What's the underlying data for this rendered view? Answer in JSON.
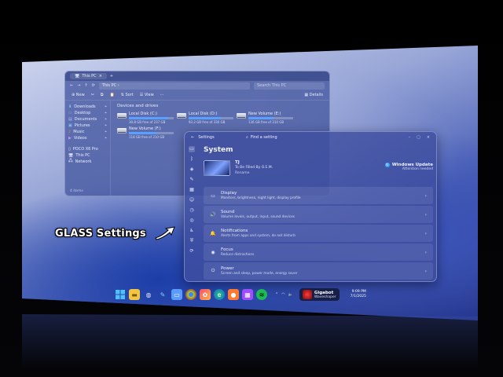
{
  "explorer": {
    "tab_title": "This PC",
    "path": "This PC",
    "search_placeholder": "Search This PC",
    "toolbar": {
      "new_label": "New",
      "sort_label": "Sort",
      "view_label": "View",
      "details_label": "Details"
    },
    "sidebar": [
      {
        "label": "Downloads",
        "icon": "download-icon"
      },
      {
        "label": "Desktop",
        "icon": "desktop-icon"
      },
      {
        "label": "Documents",
        "icon": "document-icon"
      },
      {
        "label": "Pictures",
        "icon": "picture-icon"
      },
      {
        "label": "Music",
        "icon": "music-icon"
      },
      {
        "label": "Videos",
        "icon": "video-icon"
      },
      {
        "label": "POCO X6 Pro",
        "icon": "phone-icon"
      },
      {
        "label": "This PC",
        "icon": "pc-icon"
      },
      {
        "label": "Network",
        "icon": "network-icon"
      }
    ],
    "status": "4 items",
    "section_heading": "Devices and drives",
    "drives": [
      {
        "name": "Local Disk (C:)",
        "free": "30.8 GB free of 237 GB",
        "used_fraction": 0.87
      },
      {
        "name": "Local Disk (D:)",
        "free": "93.2 GB free of 330 GB",
        "used_fraction": 0.72
      },
      {
        "name": "New Volume (E:)",
        "free": "136 GB free of 310 GB",
        "used_fraction": 0.56
      },
      {
        "name": "New Volume (F:)",
        "free": "118 GB free of 310 GB",
        "used_fraction": 0.62
      }
    ]
  },
  "settings": {
    "app_title": "Settings",
    "search_placeholder": "Find a setting",
    "page_title": "System",
    "device": {
      "name": "TJ",
      "model": "To Be Filled By O.E.M.",
      "rename": "Rename"
    },
    "windows_update": {
      "title": "Windows Update",
      "status": "Attention needed"
    },
    "items": [
      {
        "title": "Display",
        "desc": "Monitors, brightness, night light, display profile",
        "icon": "display-icon"
      },
      {
        "title": "Sound",
        "desc": "Volume levels, output, input, sound devices",
        "icon": "sound-icon"
      },
      {
        "title": "Notifications",
        "desc": "Alerts from apps and system, do not disturb",
        "icon": "bell-icon"
      },
      {
        "title": "Focus",
        "desc": "Reduce distractions",
        "icon": "focus-icon"
      },
      {
        "title": "Power",
        "desc": "Screen and sleep, power mode, energy saver",
        "icon": "power-icon"
      }
    ]
  },
  "caption": "GLASS Settings",
  "taskbar": {
    "media": {
      "song": "Gigabot",
      "artist": "Waveshaper"
    },
    "clock_time": "9:09 PM",
    "clock_date": "7/1/2025"
  },
  "colors": {
    "accent": "#3da7ff",
    "glass": "#3e4ea0"
  }
}
